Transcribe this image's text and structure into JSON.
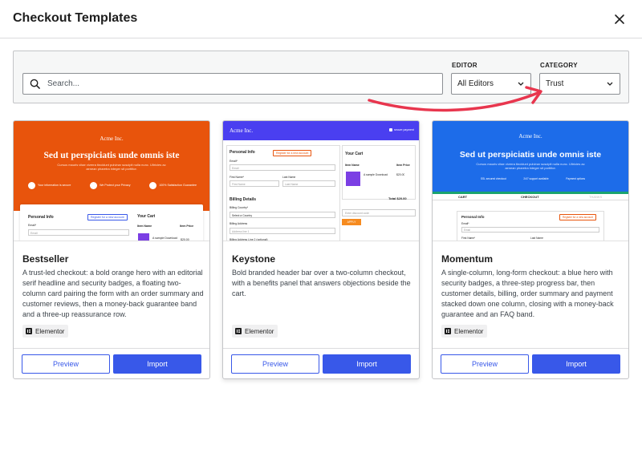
{
  "modal": {
    "title": "Checkout Templates",
    "close_icon": "close-icon"
  },
  "filters": {
    "search_placeholder": "Search...",
    "editor_label": "EDITOR",
    "editor_value": "All Editors",
    "category_label": "CATEGORY",
    "category_value": "Trust"
  },
  "colors": {
    "accent": "#3858e9",
    "annotation_arrow": "#e8364e",
    "orange": "#e8540c",
    "purple": "#4a3ff0",
    "blue": "#1d6ce9"
  },
  "cards": [
    {
      "name": "Bestseller",
      "description": "A trust-led checkout: a bold orange hero with an editorial serif headline and security badges, a floating two-column card pairing the form with an order summary and customer reviews, then a money-back guarantee band and a three-up reassurance row.",
      "editor": "Elementor",
      "preview_label": "Preview",
      "import_label": "Import",
      "thumb": {
        "brand": "Acme Inc.",
        "headline": "Sed ut perspiciatis unde omnis iste",
        "subtext": "Cursus mauris vitae viverra tincidunt pulvinar suscipit nulla nunc. Ultricies ac aenean pharetra integer sit porttitor.",
        "badges": [
          "Your information is secure",
          "We Protect your Privacy",
          "100% Satisfaction Guarantee"
        ],
        "personal_info": "Personal Info",
        "register_link": "Register for a new account",
        "email_label": "Email*",
        "email_placeholder": "Email",
        "cart_title": "Your Cart",
        "item_name_col": "Item Name",
        "item_price_col": "Item Price",
        "item_name": "A sample Download",
        "item_price": "$20.00"
      }
    },
    {
      "name": "Keystone",
      "description": "Bold branded header bar over a two-column checkout, with a benefits panel that answers objections beside the cart.",
      "editor": "Elementor",
      "preview_label": "Preview",
      "import_label": "Import",
      "thumb": {
        "brand": "Acme Inc.",
        "secure": "secure payment",
        "personal_info": "Personal Info",
        "register_link": "Register for a new account",
        "email_label": "Email*",
        "email_placeholder": "Email",
        "first_label": "First Name*",
        "first_placeholder": "First Name",
        "last_label": "Last Name",
        "last_placeholder": "Last Name",
        "billing": "Billing Details",
        "country_label": "Billing Country*",
        "country_value": "Select a Country",
        "address_label": "Billing Address",
        "address_placeholder": "Address line 1",
        "address2_label": "Billing Address Line 2 (optional)",
        "cart_title": "Your Cart",
        "item_name_col": "Item Name",
        "item_price_col": "Item Price",
        "item_name": "A sample Download",
        "item_price": "$20.00",
        "total": "Total $20.00",
        "discount_placeholder": "Enter discount code",
        "apply": "APPLY"
      }
    },
    {
      "name": "Momentum",
      "description": "A single-column, long-form checkout: a blue hero with security badges, a three-step progress bar, then customer details, billing, order summary and payment stacked down one column, closing with a money-back guarantee and an FAQ band.",
      "editor": "Elementor",
      "preview_label": "Preview",
      "import_label": "Import",
      "thumb": {
        "brand": "Acme Inc.",
        "headline": "Sed ut perspiciatis unde omnis iste",
        "subtext": "Cursus mauris vitae viverra tincidunt pulvinar suscipit nulla nunc. Ultricies ac aenean pharetra integer sit porttitor.",
        "badges": [
          "SSL secured checkout",
          "24/7 support available",
          "Payment options"
        ],
        "steps": [
          "CART",
          "CHECKOUT",
          "THANKS"
        ],
        "personal_info": "Personal Info",
        "register_link": "Register for a new account",
        "email_label": "Email*",
        "email_placeholder": "Email",
        "first_label": "First Name*",
        "last_label": "Last Name"
      }
    }
  ]
}
